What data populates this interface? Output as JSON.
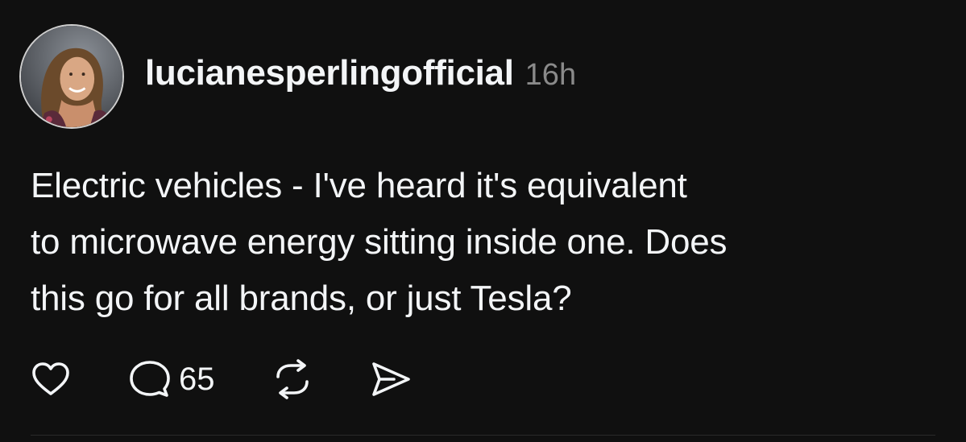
{
  "post": {
    "author": {
      "username": "lucianesperlingofficial",
      "avatar_icon": "profile-photo"
    },
    "timestamp": "16h",
    "text_lines": [
      "Electric vehicles - I've heard it's equivalent",
      "to microwave energy sitting inside one. Does",
      "this go for all brands, or just Tesla?"
    ],
    "actions": {
      "like_icon": "heart-icon",
      "reply_icon": "comment-icon",
      "reply_count": "65",
      "repost_icon": "repost-icon",
      "share_icon": "send-icon"
    }
  },
  "colors": {
    "background": "#101010",
    "text": "#f3f5f7",
    "muted": "#8a8a8a"
  }
}
